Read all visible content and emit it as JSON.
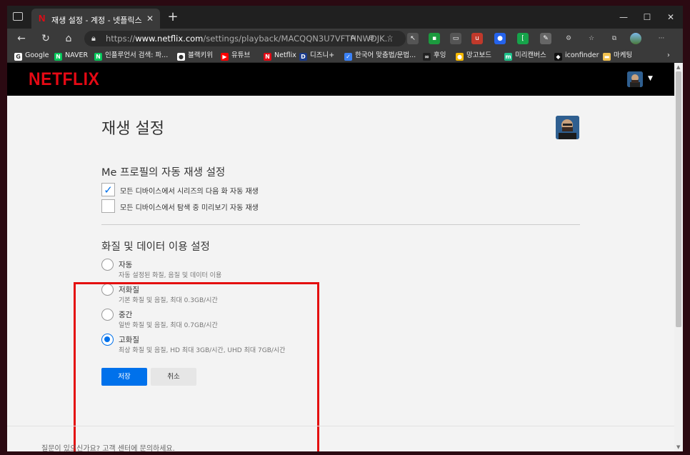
{
  "tab": {
    "title": "재생 설정 - 계정 - 넷플릭스",
    "favicon": "N"
  },
  "omnibox": {
    "url_prefix": "https://",
    "url_domain": "www.netflix.com",
    "url_path": "/settings/playback/MACQQN3U7VFTHNWDJK..."
  },
  "bookmarks": [
    {
      "label": "Google",
      "icon": "google-icon",
      "color": "#ffffff",
      "glyph": "G"
    },
    {
      "label": "NAVER",
      "icon": "naver-icon",
      "color": "#03c75a",
      "glyph": "N"
    },
    {
      "label": "인플루언서 검색: 파...",
      "icon": "naver-icon",
      "color": "#03c75a",
      "glyph": "N"
    },
    {
      "label": "블랙키위",
      "icon": "kiwi-icon",
      "color": "#ffffff",
      "glyph": "●"
    },
    {
      "label": "유튜브",
      "icon": "youtube-icon",
      "color": "#ff0000",
      "glyph": "▶"
    },
    {
      "label": "Netflix",
      "icon": "netflix-icon",
      "color": "#e50914",
      "glyph": "N"
    },
    {
      "label": "디즈니+",
      "icon": "disney-icon",
      "color": "#1a3a8a",
      "glyph": "D"
    },
    {
      "label": "한국어 맞춤법/문법...",
      "icon": "spellcheck-icon",
      "color": "#3b82f6",
      "glyph": "✓"
    },
    {
      "label": "후잉",
      "icon": "whooing-icon",
      "color": "#222222",
      "glyph": "∞"
    },
    {
      "label": "망고보드",
      "icon": "mango-icon",
      "color": "#f5b800",
      "glyph": "●"
    },
    {
      "label": "미리캔버스",
      "icon": "miricanvas-icon",
      "color": "#1ec28b",
      "glyph": "m"
    },
    {
      "label": "iconfinder",
      "icon": "iconfinder-icon",
      "color": "#111111",
      "glyph": "◆"
    },
    {
      "label": "마케팅",
      "icon": "folder-icon",
      "color": "#f2c14e",
      "glyph": "▬"
    }
  ],
  "netflix": {
    "logo": "NETFLIX",
    "page_title": "재생 설정",
    "autoplay_section_title": "Me 프로필의 자동 재생 설정",
    "autoplay_options": [
      {
        "label": "모든 디바이스에서 시리즈의 다음 화 자동 재생",
        "checked": true
      },
      {
        "label": "모든 디바이스에서 탐색 중 미리보기 자동 재생",
        "checked": false
      }
    ],
    "quality_section_title": "화질 및 데이터 이용 설정",
    "quality_options": [
      {
        "label": "자동",
        "desc": "자동 설정된 화질, 음질 및 데이터 이용",
        "selected": false
      },
      {
        "label": "저화질",
        "desc": "기본 화질 및 음질, 최대 0.3GB/시간",
        "selected": false
      },
      {
        "label": "중간",
        "desc": "일반 화질 및 음질, 최대 0.7GB/시간",
        "selected": false
      },
      {
        "label": "고화질",
        "desc": "최상 화질 및 음질, HD 최대 3GB/시간, UHD 최대 7GB/시간",
        "selected": true
      }
    ],
    "save_label": "저장",
    "cancel_label": "취소",
    "footer_text": "질문이 있으신가요? 고객 센터에 문의하세요."
  },
  "colors": {
    "netflix_red": "#e50914",
    "accent_blue": "#0071eb",
    "highlight_red": "#e40f0f"
  }
}
